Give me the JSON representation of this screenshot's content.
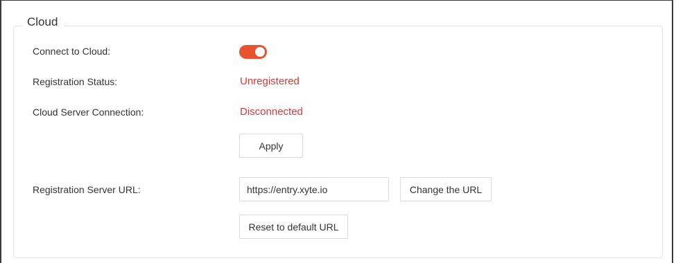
{
  "section": {
    "title": "Cloud"
  },
  "fields": {
    "connect_label": "Connect to Cloud:",
    "connect_enabled": true,
    "registration_status_label": "Registration Status:",
    "registration_status_value": "Unregistered",
    "server_connection_label": "Cloud Server Connection:",
    "server_connection_value": "Disconnected",
    "registration_url_label": "Registration Server URL:",
    "registration_url_value": "https://entry.xyte.io"
  },
  "buttons": {
    "apply": "Apply",
    "change_url": "Change the URL",
    "reset_url": "Reset to default URL"
  },
  "colors": {
    "toggle_on": "#e8522e",
    "status_error": "#d9383a"
  }
}
